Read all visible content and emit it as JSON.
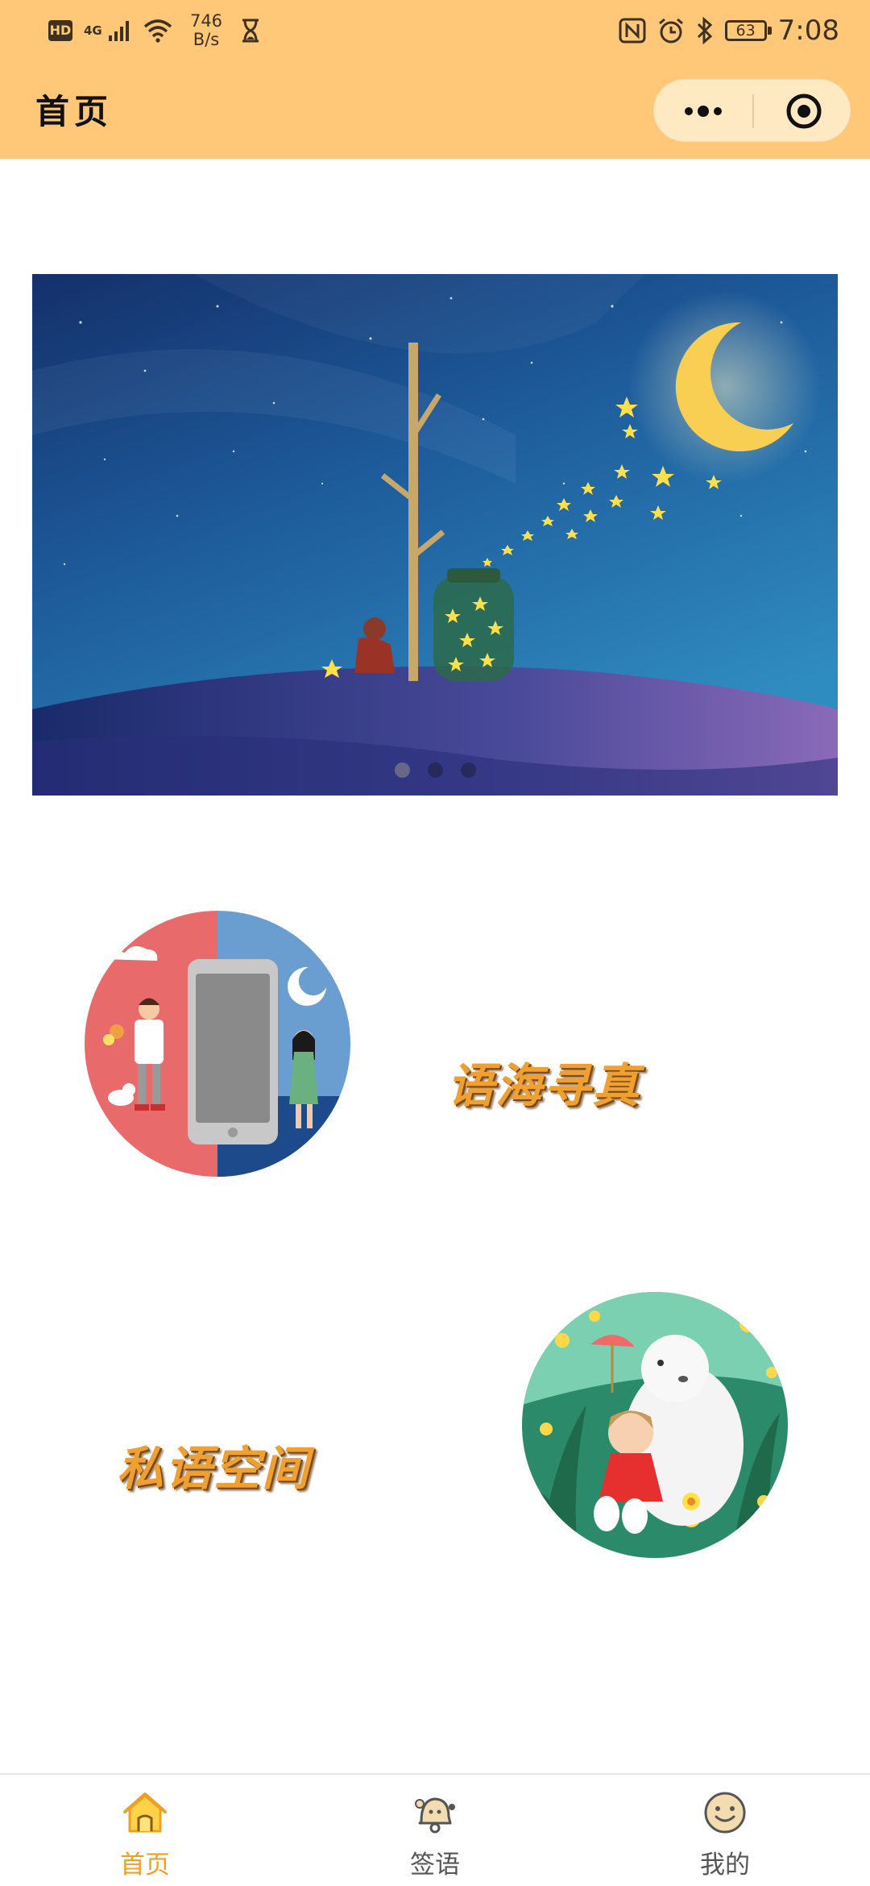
{
  "status_bar": {
    "hd": "HD",
    "network": "4G",
    "speed_value": "746",
    "speed_unit": "B/s",
    "battery": "63",
    "time": "7:08"
  },
  "nav": {
    "title": "首页",
    "capsule_icons": [
      "more-dots-icon",
      "target-close-icon"
    ]
  },
  "banner": {
    "slides": 3,
    "active_index": 0
  },
  "features": [
    {
      "label": "语海寻真",
      "image": "phone-couple-illustration"
    },
    {
      "label": "私语空间",
      "image": "polar-bear-girl-illustration"
    }
  ],
  "tabbar": {
    "items": [
      {
        "label": "首页",
        "icon": "home-icon",
        "active": true
      },
      {
        "label": "签语",
        "icon": "bell-chat-icon",
        "active": false
      },
      {
        "label": "我的",
        "icon": "smiley-face-icon",
        "active": false
      }
    ]
  },
  "colors": {
    "header_bg": "#ffc878",
    "accent": "#f0a020",
    "capsule_bg": "#ffe9c2"
  }
}
